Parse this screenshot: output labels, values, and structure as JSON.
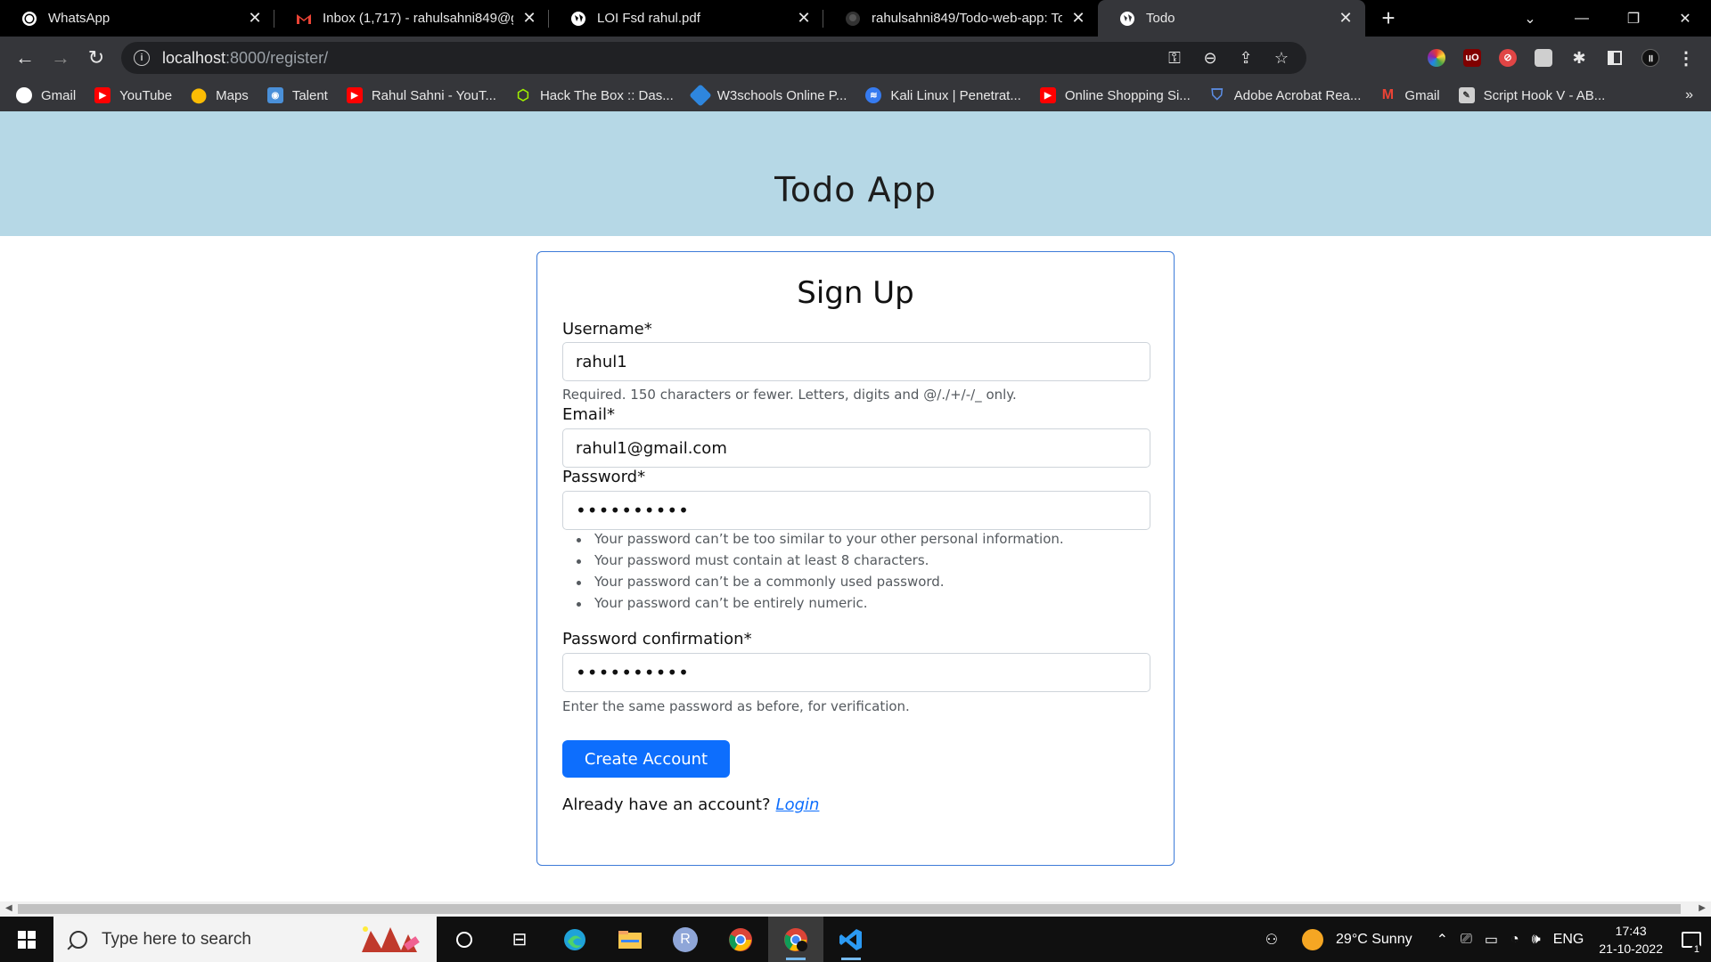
{
  "browser": {
    "tabs": [
      {
        "title": "WhatsApp",
        "icon": "whatsapp-icon",
        "active": false
      },
      {
        "title": "Inbox (1,717) - rahulsahni849@g",
        "icon": "gmail-icon",
        "active": false
      },
      {
        "title": "LOI Fsd rahul.pdf",
        "icon": "globe-icon",
        "active": false
      },
      {
        "title": "rahulsahni849/Todo-web-app: To",
        "icon": "github-icon",
        "active": false
      },
      {
        "title": "Todo",
        "icon": "globe-icon",
        "active": true
      }
    ],
    "url_host": "localhost",
    "url_path": ":8000/register/",
    "bookmarks": [
      {
        "label": "Gmail",
        "icon": "globe-icon",
        "color": "#ffffff"
      },
      {
        "label": "YouTube",
        "icon": "youtube-icon",
        "color": "#ff0000"
      },
      {
        "label": "Maps",
        "icon": "maps-icon",
        "color": "#34a853"
      },
      {
        "label": "Talent",
        "icon": "talent-icon",
        "color": "#4a90d9"
      },
      {
        "label": "Rahul Sahni - YouT...",
        "icon": "youtube-icon",
        "color": "#ff0000"
      },
      {
        "label": "Hack The Box :: Das...",
        "icon": "htb-icon",
        "color": "#9fef00"
      },
      {
        "label": "W3schools Online P...",
        "icon": "w3schools-icon",
        "color": "#2e86de"
      },
      {
        "label": "Kali Linux | Penetrat...",
        "icon": "kali-icon",
        "color": "#367bf0"
      },
      {
        "label": "Online Shopping Si...",
        "icon": "youtube-icon",
        "color": "#ff0000"
      },
      {
        "label": "Adobe Acrobat Rea...",
        "icon": "shield-icon",
        "color": "#5c8ee6"
      },
      {
        "label": "Gmail",
        "icon": "gmail-icon",
        "color": "#ea4335"
      },
      {
        "label": "Script Hook V - AB...",
        "icon": "script-icon",
        "color": "#cfcfcf"
      }
    ]
  },
  "page": {
    "site_title": "Todo App",
    "form_title": "Sign Up",
    "username_label": "Username*",
    "username_value": "rahul1",
    "username_help": "Required. 150 characters or fewer. Letters, digits and @/./+/-/_ only.",
    "email_label": "Email*",
    "email_value": "rahul1@gmail.com",
    "password_label": "Password*",
    "password_value": "••••••••••",
    "password_help": [
      "Your password can’t be too similar to your other personal information.",
      "Your password must contain at least 8 characters.",
      "Your password can’t be a commonly used password.",
      "Your password can’t be entirely numeric."
    ],
    "password2_label": "Password confirmation*",
    "password2_value": "••••••••••",
    "password2_help": "Enter the same password as before, for verification.",
    "submit_label": "Create Account",
    "login_prompt": "Already have an account?",
    "login_link": "Login"
  },
  "taskbar": {
    "search_placeholder": "Type here to search",
    "weather": "29°C  Sunny",
    "language": "ENG",
    "time": "17:43",
    "date": "21-10-2022",
    "notification_count": "1"
  },
  "colors": {
    "header_bg": "#b6d8e6",
    "primary": "#0d6efd",
    "card_border": "#3d7bd8"
  }
}
